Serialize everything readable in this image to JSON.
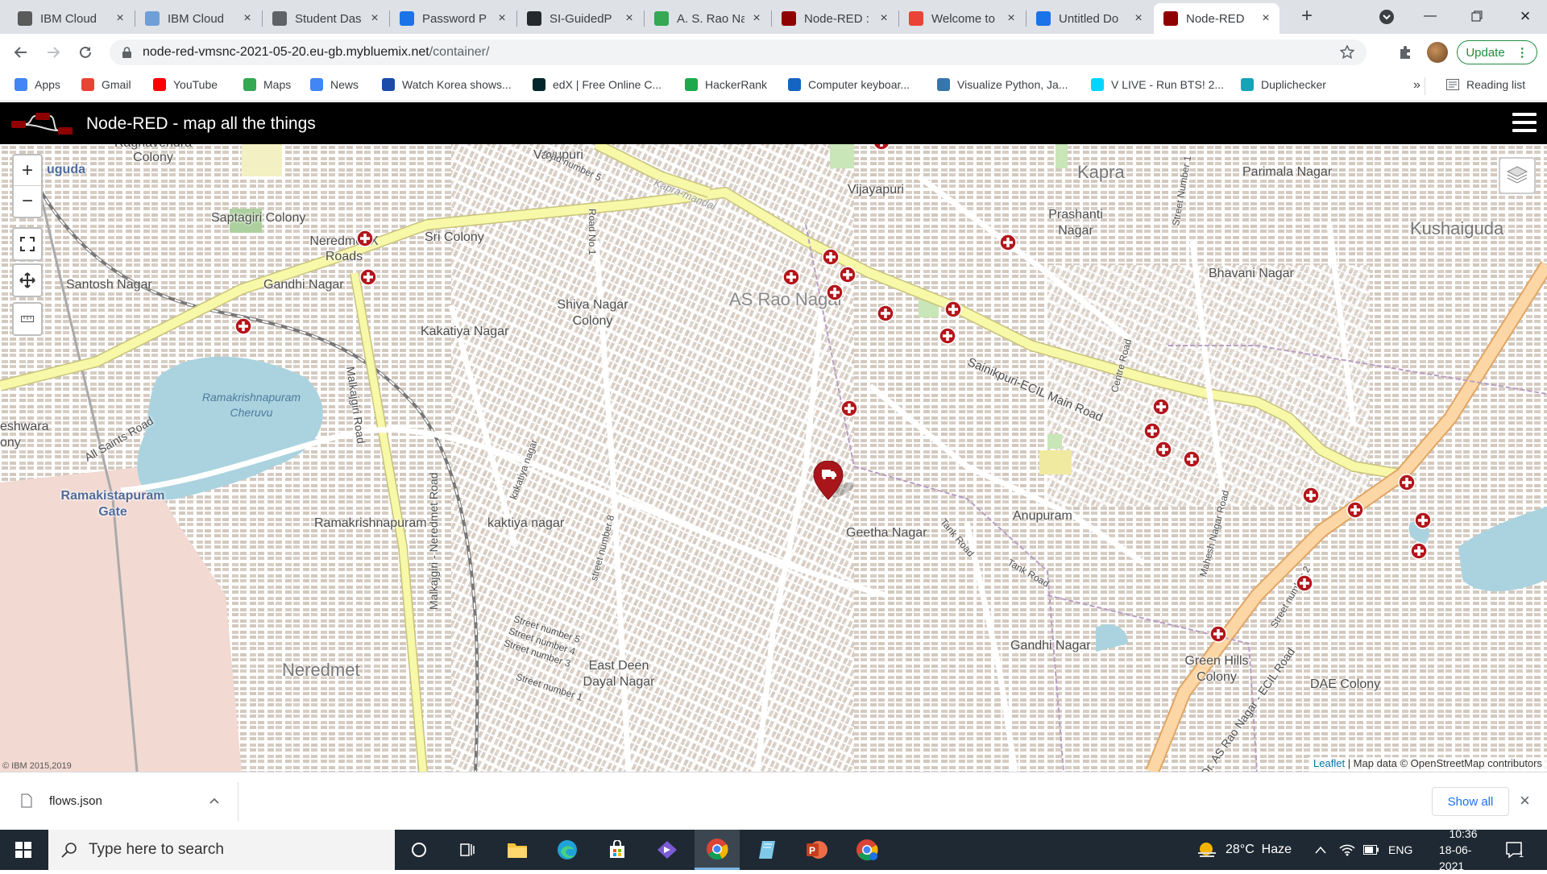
{
  "browser": {
    "tabs": [
      {
        "title": "IBM Cloud",
        "icon": "ibm-cloud-icon",
        "color": "#5a5a5a"
      },
      {
        "title": "IBM Cloud",
        "icon": "cloud-icon",
        "color": "#6f9fd8"
      },
      {
        "title": "Student Das",
        "icon": "globe-icon",
        "color": "#5f6368"
      },
      {
        "title": "Password P",
        "icon": "edit-doc-icon",
        "color": "#1a73e8"
      },
      {
        "title": "SI-GuidedP",
        "icon": "github-icon",
        "color": "#24292e"
      },
      {
        "title": "A. S. Rao Na",
        "icon": "maps-pin-icon",
        "color": "#34a853"
      },
      {
        "title": "Node-RED :",
        "icon": "node-red-icon",
        "color": "#8f0000"
      },
      {
        "title": "Welcome to",
        "icon": "gmail-icon",
        "color": "#ea4335"
      },
      {
        "title": "Untitled Do",
        "icon": "edit-doc-icon",
        "color": "#1a73e8"
      },
      {
        "title": "Node-RED",
        "icon": "node-red-icon",
        "color": "#8f0000",
        "active": true
      }
    ],
    "url_host": "node-red-vmsnc-2021-05-20.eu-gb.mybluemix.net",
    "url_path": "/container/",
    "update_label": "Update",
    "bookmarks": [
      {
        "label": "Apps",
        "icon": "apps-grid-icon",
        "color": "#4285f4"
      },
      {
        "label": "Gmail",
        "icon": "gmail-icon",
        "color": "#ea4335"
      },
      {
        "label": "YouTube",
        "icon": "youtube-icon",
        "color": "#ff0000"
      },
      {
        "label": "Maps",
        "icon": "maps-pin-icon",
        "color": "#34a853"
      },
      {
        "label": "News",
        "icon": "news-icon",
        "color": "#4285f4"
      },
      {
        "label": "Watch Korea shows...",
        "icon": "r-icon",
        "color": "#1a4ba8"
      },
      {
        "label": "edX | Free Online C...",
        "icon": "edx-icon",
        "color": "#02262b"
      },
      {
        "label": "HackerRank",
        "icon": "hackerrank-icon",
        "color": "#1ba94c"
      },
      {
        "label": "Computer keyboar...",
        "icon": "c-icon",
        "color": "#1565c0"
      },
      {
        "label": "Visualize Python, Ja...",
        "icon": "python-icon",
        "color": "#3776ab"
      },
      {
        "label": "V LIVE - Run BTS! 2...",
        "icon": "vlive-icon",
        "color": "#00d5ff"
      },
      {
        "label": "Duplichecker",
        "icon": "duplichecker-icon",
        "color": "#17a2b8"
      }
    ],
    "more_bookmarks": "»",
    "reading_list": "Reading list"
  },
  "app": {
    "title": "Node-RED - map all the things"
  },
  "map": {
    "labels": [
      "Raghavendra Colony",
      "Vayupuri",
      "Vijayapuri",
      "Kapra",
      "Parimala Nagar",
      "Saptagiri Colony",
      "Neredmet X Roads",
      "Sri Colony",
      "Prashanti Nagar",
      "Kushaiguda",
      "Santosh Nagar",
      "Gandhi Nagar",
      "Bhavani Nagar",
      "Shiva Nagar Colony",
      "AS Rao Nagar",
      "Kakatiya Nagar",
      "Ramakistapuram Gate",
      "Ramakrishnapuram Cheruvu",
      "Ramakrishnapuram",
      "kaktiya nagar",
      "Geetha Nagar",
      "Anupuram",
      "Neredmet",
      "East Deen Dayal Nagar",
      "Gandhi Nagar",
      "Green Hills Colony",
      "DAE Colony",
      "Sainikpuri-ECIL Main Road",
      "All Saints Road",
      "Malkajgiri Road",
      "Malkajgiri - Neredmet Road",
      "Tank Road",
      "Tank Road",
      "Kapra-mandal",
      "Road No 1",
      "Centre Road",
      "Street Number 1",
      "Mahesh Nagar Road",
      "Street number 2",
      "Dr. AS Rao Nagar - ECIL Road",
      "road number 5",
      "Street number 5",
      "Street number 4",
      "Street number 3",
      "Street number 1",
      "street number 8",
      "kakatiya nagar",
      "uguda",
      "eshwara",
      "ony"
    ],
    "markers_label": "hospital-marker",
    "vehicle_marker": "truck-pin-icon",
    "attribution_link": "Leaflet",
    "attribution_text": " | Map data © OpenStreetMap contributors",
    "copyright": "© IBM 2015,2019"
  },
  "download": {
    "filename": "flows.json",
    "show_all": "Show all"
  },
  "taskbar": {
    "search_placeholder": "Type here to search",
    "weather": "28°C  Haze",
    "language": "ENG",
    "time": "10:36",
    "date": "18-06-2021",
    "notification_count": "1"
  }
}
